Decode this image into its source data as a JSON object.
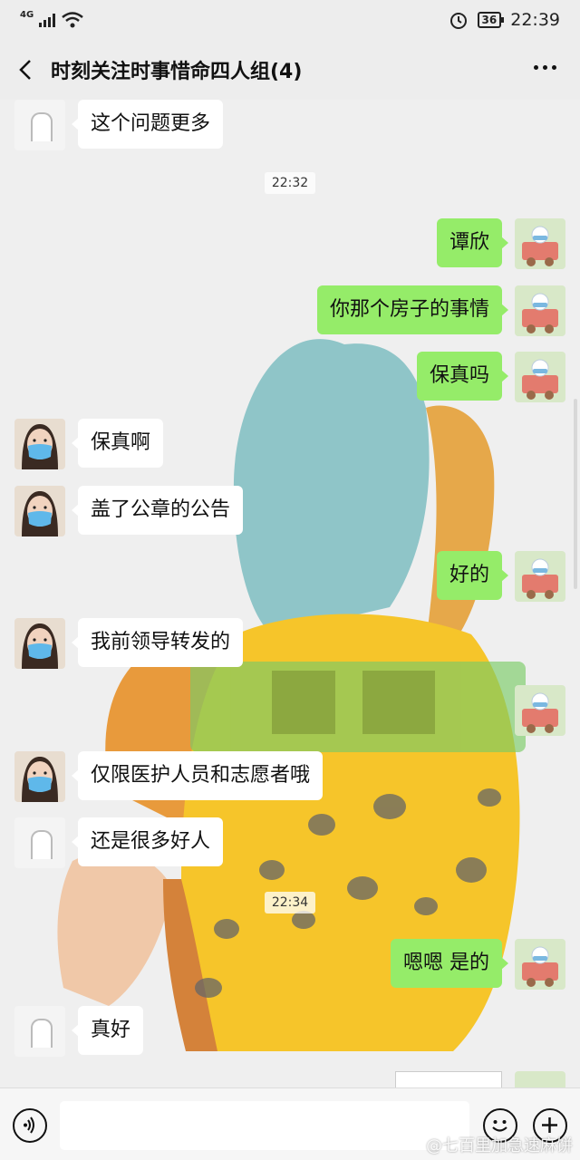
{
  "status": {
    "network": "4G",
    "battery": "36",
    "time": "22:39"
  },
  "header": {
    "title": "时刻关注时事惜命四人组(4)"
  },
  "timestamps": [
    "22:32",
    "22:34"
  ],
  "messages": [
    {
      "side": "left",
      "avatar": "gray-arch-avatar",
      "text": "这个问题更多"
    },
    {
      "side": "right",
      "avatar": "cartoon-train-avatar",
      "text": "谭欣"
    },
    {
      "side": "right",
      "avatar": "cartoon-train-avatar",
      "text": "你那个房子的事情"
    },
    {
      "side": "right",
      "avatar": "cartoon-train-avatar",
      "text": "保真吗"
    },
    {
      "side": "left",
      "avatar": "masked-girl-avatar",
      "text": "保真啊"
    },
    {
      "side": "left",
      "avatar": "masked-girl-avatar",
      "text": "盖了公章的公告"
    },
    {
      "side": "right",
      "avatar": "cartoon-train-avatar",
      "text": "好的"
    },
    {
      "side": "left",
      "avatar": "masked-girl-avatar",
      "text": "我前领导转发的"
    },
    {
      "side": "left",
      "avatar": "masked-girl-avatar",
      "text": "仅限医护人员和志愿者哦"
    },
    {
      "side": "left",
      "avatar": "gray-arch-avatar",
      "text": "还是很多好人"
    },
    {
      "side": "right",
      "avatar": "cartoon-train-avatar",
      "text": "嗯嗯 是的"
    },
    {
      "side": "left",
      "avatar": "gray-arch-avatar",
      "text": "真好"
    }
  ],
  "input": {
    "placeholder": ""
  },
  "watermark": "@七百里加急速麻饼",
  "colors": {
    "sent_bubble": "#95ec69",
    "received_bubble": "#ffffff",
    "background": "#ededed"
  }
}
